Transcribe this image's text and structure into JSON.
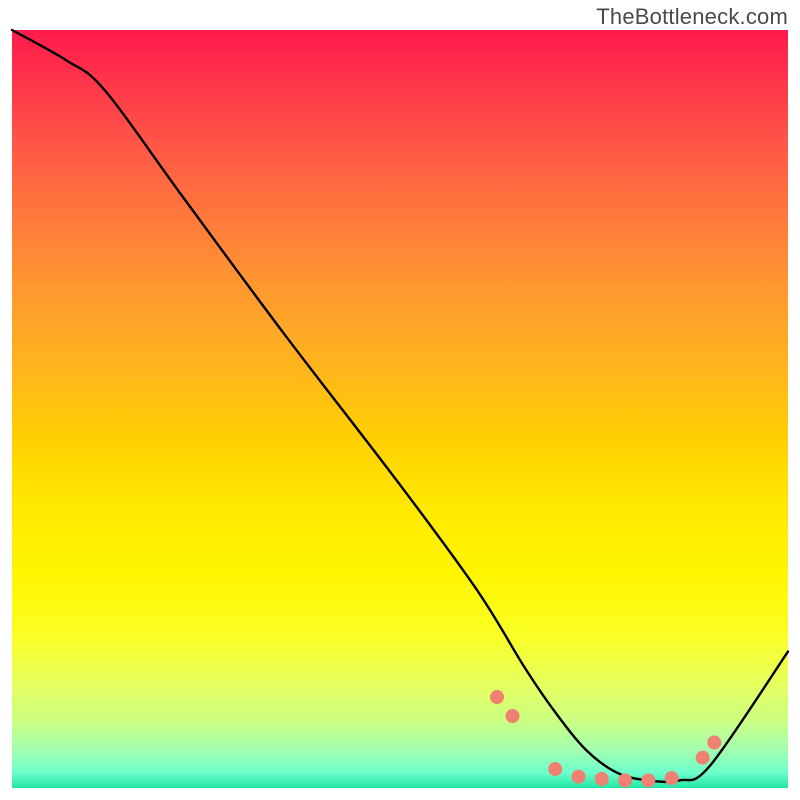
{
  "watermark": "TheBottleneck.com",
  "chart_data": {
    "type": "line",
    "title": "",
    "xlabel": "",
    "ylabel": "",
    "xlim": [
      0,
      100
    ],
    "ylim": [
      0,
      100
    ],
    "grid": false,
    "series": [
      {
        "name": "curve",
        "x": [
          0,
          7,
          12,
          22,
          35,
          50,
          60,
          66,
          70,
          74,
          78,
          82,
          86,
          90,
          100
        ],
        "values": [
          100,
          96,
          92,
          78,
          60,
          40,
          26,
          16,
          10,
          5,
          2,
          1,
          1,
          3,
          18
        ]
      }
    ],
    "markers": {
      "name": "dots",
      "color": "#f08072",
      "x": [
        62.5,
        64.5,
        70.0,
        73.0,
        76.0,
        79.0,
        82.0,
        85.0,
        89.0,
        90.5
      ],
      "values": [
        12.0,
        9.5,
        2.5,
        1.5,
        1.2,
        1.0,
        1.0,
        1.3,
        4.0,
        6.0
      ]
    },
    "background_gradient": {
      "top": "#ff1a4d",
      "mid": "#ffe900",
      "bottom": "#21e6a4"
    }
  }
}
